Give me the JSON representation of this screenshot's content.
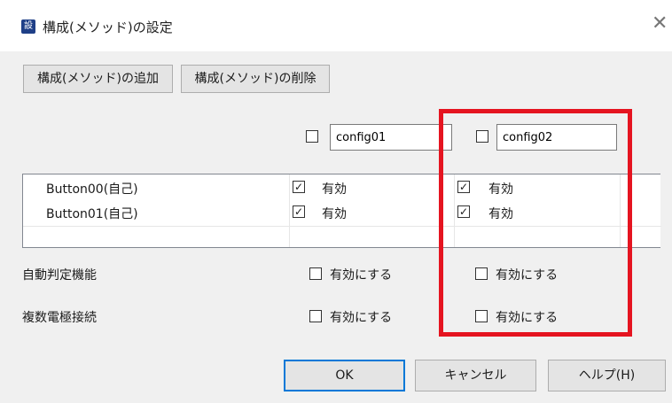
{
  "window": {
    "title": "構成(メソッド)の設定",
    "app_icon_glyph": "設",
    "close_glyph": "✕"
  },
  "toolbar": {
    "add_label": "構成(メソッド)の追加",
    "delete_label": "構成(メソッド)の削除"
  },
  "configs": [
    {
      "name": "config01",
      "checked": false
    },
    {
      "name": "config02",
      "checked": false
    }
  ],
  "table": {
    "rows": [
      {
        "label": "Button00(自己)",
        "cells": [
          {
            "checked": true,
            "text": "有効"
          },
          {
            "checked": true,
            "text": "有効"
          }
        ]
      },
      {
        "label": "Button01(自己)",
        "cells": [
          {
            "checked": true,
            "text": "有効"
          },
          {
            "checked": true,
            "text": "有効"
          }
        ]
      }
    ]
  },
  "options": [
    {
      "label": "自動判定機能",
      "enable_text": "有効にする",
      "values": [
        false,
        false
      ]
    },
    {
      "label": "複数電極接続",
      "enable_text": "有効にする",
      "values": [
        false,
        false
      ]
    }
  ],
  "footer": {
    "ok_label": "OK",
    "cancel_label": "キャンセル",
    "help_label": "ヘルプ(H)"
  },
  "colors": {
    "highlight": "#e51420",
    "accent": "#0078d7"
  },
  "icons": {
    "checked_glyph": "✓"
  }
}
